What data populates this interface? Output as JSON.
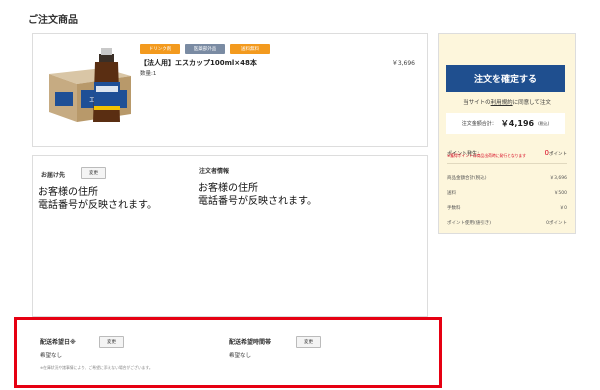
{
  "page": {
    "heading": "ご注文商品"
  },
  "product": {
    "tags": [
      {
        "label": "ドリンク剤",
        "color": "#f39a1e"
      },
      {
        "label": "医薬部外品",
        "color": "#7a8ba3"
      },
      {
        "label": "送料無料",
        "color": "#f39a1e"
      }
    ],
    "name": "【法人用】エスカップ100ml×48本",
    "quantity": "数量:1",
    "price": "￥3,696",
    "image_icon": "drink-case-image",
    "image_box_text": "エスカップ"
  },
  "delivery_address": {
    "label": "お届け先",
    "change_label": "変更",
    "text_line1": "お客様の住所",
    "text_line2": "電話番号が反映されます。"
  },
  "orderer": {
    "label": "注文者情報",
    "text_line1": "お客様の住所",
    "text_line2": "電話番号が反映されます。"
  },
  "sidebar": {
    "confirm_label": "注文を確定する",
    "agree_prefix": "当サイトの",
    "agree_link": "利用規約",
    "agree_suffix": "に同意して注文",
    "total_label": "注文金額合計：",
    "total_value": "￥4,196",
    "total_tax": "(税込)",
    "points_label": "ポイント発生：",
    "points_value": "0",
    "points_unit": "ポイント",
    "points_note": "※獲得ポイントは商品出荷時に発行となります",
    "breakdown": [
      {
        "label": "商品金額合計(税込)",
        "value": "￥3,696"
      },
      {
        "label": "送料",
        "value": "￥500"
      },
      {
        "label": "手数料",
        "value": "￥0"
      },
      {
        "label": "ポイント使用(値引き)",
        "value": "0ポイント"
      }
    ],
    "accent_color": "#1f4f8f"
  },
  "delivery_options": {
    "date_label": "配送希望日※",
    "date_change": "変更",
    "date_value": "希望なし",
    "time_label": "配送希望時間帯",
    "time_change": "変更",
    "time_value": "希望なし",
    "note": "※在庫状況や諸事情により、ご希望に添えない場合がございます。",
    "highlight_color": "#e60012"
  }
}
